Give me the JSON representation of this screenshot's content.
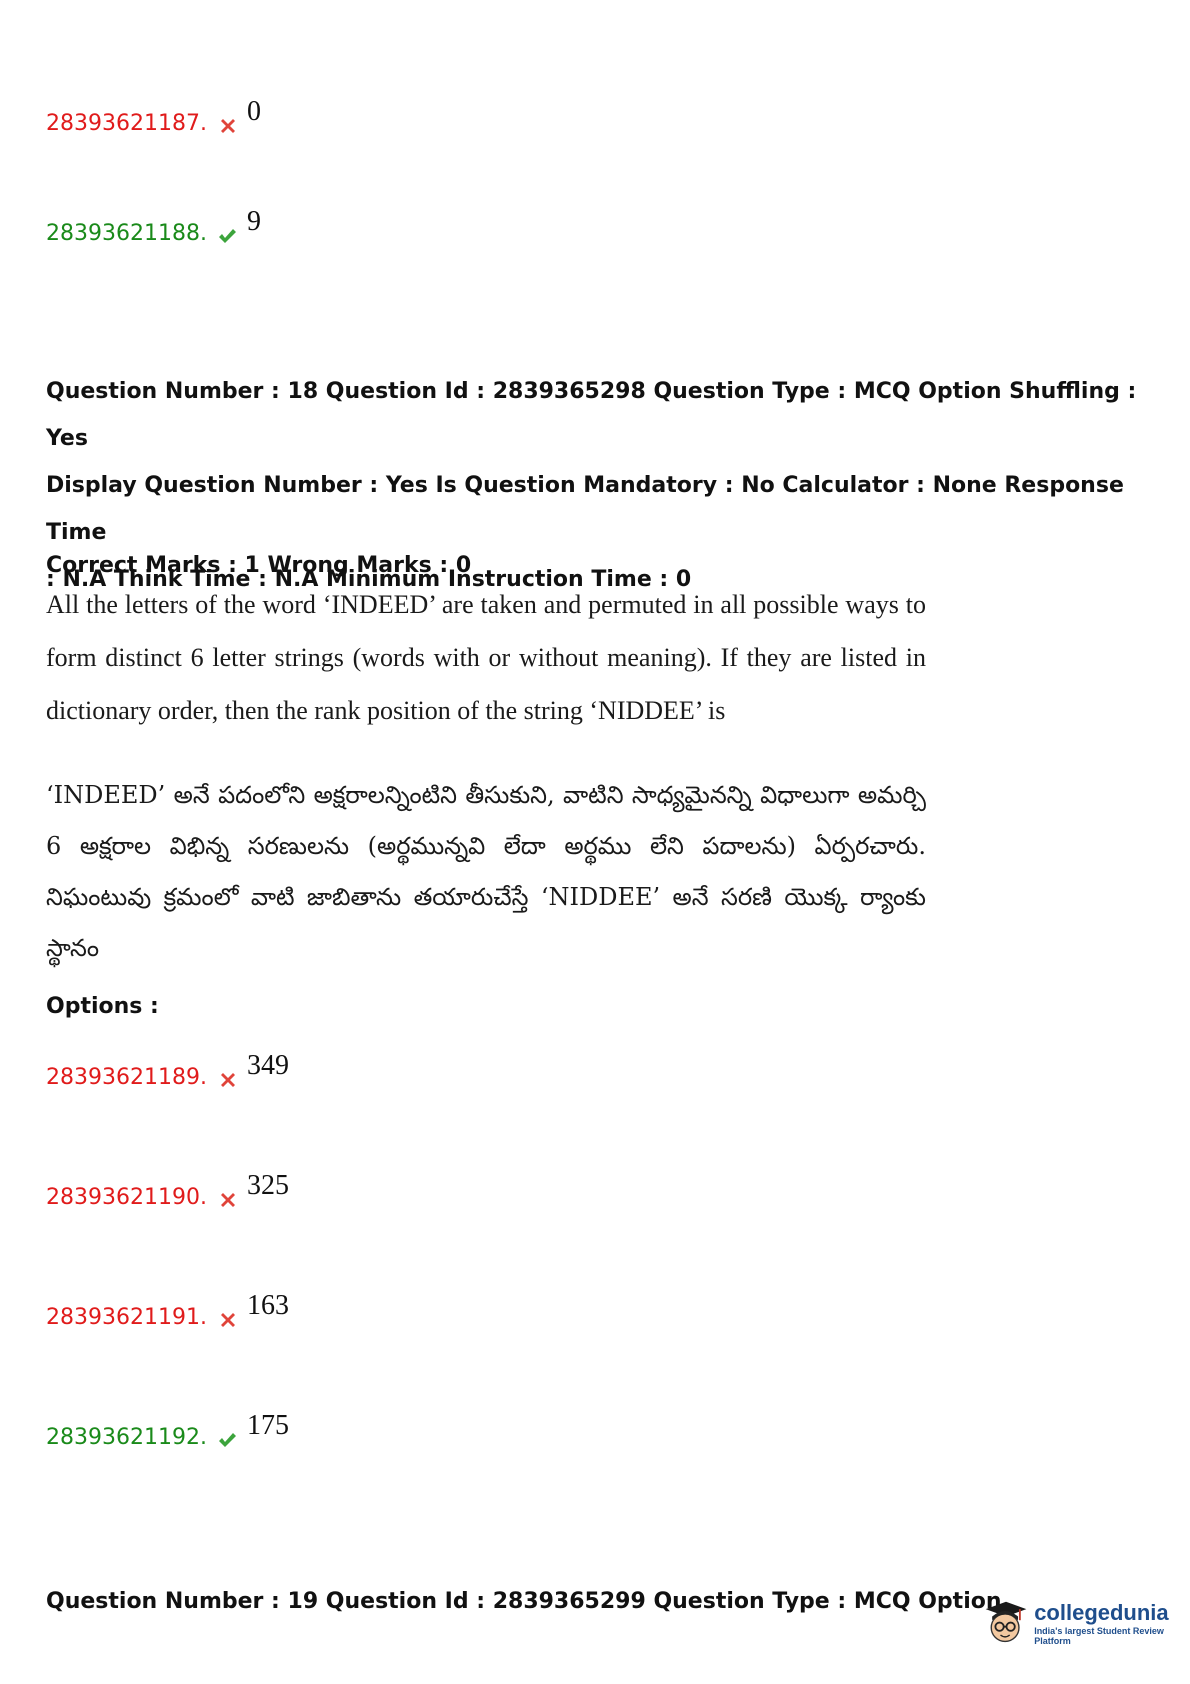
{
  "prev_options": [
    {
      "id": "28393621187.",
      "status": "wrong",
      "value": "0"
    },
    {
      "id": "28393621188.",
      "status": "correct",
      "value": "9"
    }
  ],
  "question18": {
    "meta_line1": "Question Number : 18 Question Id : 2839365298 Question Type : MCQ Option Shuffling : Yes",
    "meta_line2": "Display Question Number : Yes Is Question Mandatory : No Calculator : None Response Time",
    "meta_line3": ": N.A Think Time : N.A Minimum Instruction Time : 0",
    "marks": "Correct Marks : 1 Wrong Marks : 0",
    "text_en": "All the letters of the word ‘INDEED’ are taken and permuted in all possible ways to form distinct 6 letter strings (words with or without meaning). If they are listed in dictionary order, then the rank position of the string ‘NIDDEE’ is",
    "text_te": "‘INDEED’ అనే పదంలోని అక్షరాలన్నింటిని తీసుకుని, వాటిని సాధ్యమైనన్ని విధాలుగా అమర్చి 6 అక్షరాల విభిన్న సరణులను (అర్థమున్నవి లేదా అర్థము లేని పదాలను) ఏర్పరచారు. నిఘంటువు క్రమంలో వాటి జాబితాను తయారుచేస్తే ‘NIDDEE’ అనే సరణి యొక్క ర్యాంకు స్థానం",
    "options_label": "Options :",
    "options": [
      {
        "id": "28393621189.",
        "status": "wrong",
        "value": "349"
      },
      {
        "id": "28393621190.",
        "status": "wrong",
        "value": "325"
      },
      {
        "id": "28393621191.",
        "status": "wrong",
        "value": "163"
      },
      {
        "id": "28393621192.",
        "status": "correct",
        "value": "175"
      }
    ]
  },
  "question19": {
    "meta_line1": "Question Number : 19 Question Id : 2839365299 Question Type : MCQ Option"
  },
  "logo": {
    "name": "collegedunia",
    "tagline": "India's largest Student Review Platform",
    "brand_color": "#1f4e8c"
  },
  "icons": {
    "wrong": "cross-icon",
    "correct": "check-icon"
  },
  "colors": {
    "wrong": "#e01b1b",
    "correct": "#1a8a1a"
  }
}
